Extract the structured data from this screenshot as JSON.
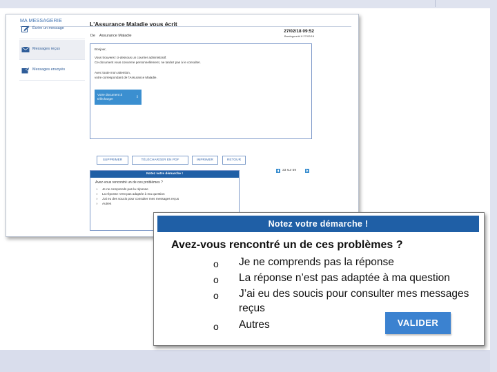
{
  "window": {
    "title": "MA MESSAGERIE"
  },
  "sidebar": {
    "items": [
      {
        "label": "Écrire un message",
        "icon": "pencil-icon"
      },
      {
        "label": "Messages reçus",
        "icon": "envelope-icon"
      },
      {
        "label": "Messages envoyés",
        "icon": "sent-icon"
      }
    ]
  },
  "message": {
    "title": "L'Assurance Maladie vous écrit",
    "date": "27/02/18 09:52",
    "meta": "Bwalugunnbf 8 27/02/18",
    "from_label": "De",
    "from": "Assurance Maladie",
    "body": [
      "Bonjour,",
      "Vous trouverez ci-dessous un courrier administratif.",
      "Ce document vous concerne personnellement, ne tardez pas à le consulter.",
      "Avec toute mon attention,",
      "votre correspondant de l'Assurance Maladie."
    ],
    "download_label": "Votre document à télécharger"
  },
  "actions": [
    "SUPPRIMER",
    "TÉLÉCHARGER EN PDF",
    "IMPRIMER",
    "RETOUR"
  ],
  "pager": {
    "text": "33 sur 59"
  },
  "small_survey": {
    "header": "Notez votre démarche !",
    "question": "Avez-vous rencontré un de ces problèmes ?",
    "options": [
      "Je ne comprends pas la réponse",
      "La réponse n'est pas adaptée à ma question",
      "J'ai eu des soucis pour consulter mes messages reçus",
      "Autres"
    ]
  },
  "survey": {
    "header": "Notez votre démarche !",
    "question": "Avez-vous rencontré un de ces problèmes ?",
    "bullet": "o",
    "options": [
      "Je ne comprends pas la réponse",
      "La réponse n’est pas adaptée à ma question",
      "J’ai eu des soucis pour consulter mes messages reçus",
      "Autres"
    ],
    "submit_label": "VALIDER"
  },
  "colors": {
    "accent": "#1f5fa6",
    "button": "#3b82d0",
    "link": "#2f5d99"
  }
}
